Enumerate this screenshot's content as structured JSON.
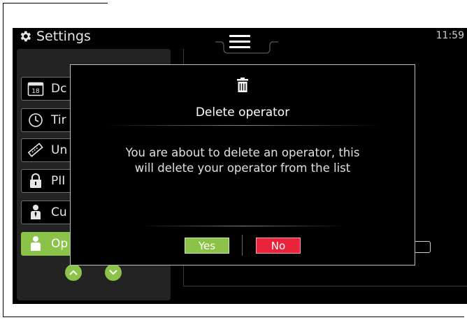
{
  "header": {
    "title": "Settings",
    "clock": "11:59",
    "settings_icon": "gear-icon",
    "menu_icon": "hamburger-menu-icon"
  },
  "sidebar": {
    "items": [
      {
        "label": "Dc",
        "icon": "calendar-icon",
        "calendar_day": "18"
      },
      {
        "label": "Tir",
        "icon": "clock-icon"
      },
      {
        "label": "Un",
        "icon": "ruler-icon"
      },
      {
        "label": "PII",
        "icon": "lock-icon"
      },
      {
        "label": "Cu",
        "icon": "person-tie-icon"
      },
      {
        "label": "Op",
        "icon": "person-icon",
        "active": true
      }
    ],
    "scroll_up_icon": "chevron-up-icon",
    "scroll_down_icon": "chevron-down-icon"
  },
  "operators_panel": {
    "add_label": "+",
    "delete_icon": "trash-icon"
  },
  "dialog": {
    "icon": "trash-icon",
    "title": "Delete operator",
    "message": "You are about to delete an operator, this\nwill delete your operator from the list",
    "yes_label": "Yes",
    "no_label": "No"
  },
  "colors": {
    "accent_green": "#8bc34a",
    "danger_red": "#e8233a",
    "background": "#000000"
  }
}
